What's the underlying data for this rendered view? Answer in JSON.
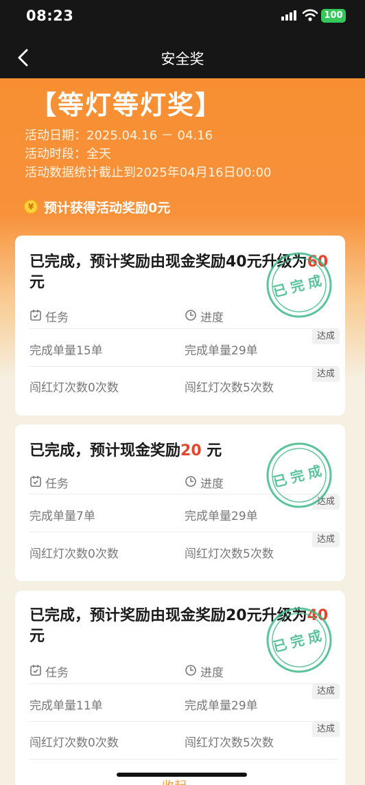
{
  "status_bar": {
    "time": "08:23",
    "battery": "100"
  },
  "nav": {
    "title": "安全奖"
  },
  "hero": {
    "title": "【等灯等灯奖】",
    "date_line": "活动日期：2025.04.16 － 04.16",
    "period_line": "活动时段：全天",
    "stats_line": "活动数据统计截止到2025年04月16日00:00",
    "coin_symbol": "¥",
    "reward": "预计获得活动奖励0元"
  },
  "headers": {
    "task": "任务",
    "progress": "进度"
  },
  "badge_text": "达成",
  "stamp_text": "已完成",
  "cards": [
    {
      "title_text": "已完成，预计奖励由现金奖励40元升级为",
      "amount": "60",
      "unit": " 元",
      "rows": [
        {
          "task": "完成单量15单",
          "progress": "完成单量29单"
        },
        {
          "task": "闯红灯次数0次数",
          "progress": "闯红灯次数5次数"
        }
      ]
    },
    {
      "title_text": "已完成，预计现金奖励",
      "amount": "20",
      "unit": " 元",
      "rows": [
        {
          "task": "完成单量7单",
          "progress": "完成单量29单"
        },
        {
          "task": "闯红灯次数0次数",
          "progress": "闯红灯次数5次数"
        }
      ]
    },
    {
      "title_text": "已完成，预计奖励由现金奖励20元升级为",
      "amount": "40",
      "unit": " 元",
      "rows": [
        {
          "task": "完成单量11单",
          "progress": "完成单量29单"
        },
        {
          "task": "闯红灯次数0次数",
          "progress": "闯红灯次数5次数"
        }
      ]
    }
  ],
  "footer": {
    "collapse": "收起"
  },
  "colors": {
    "accent_orange": "#f78f32",
    "amount_red": "#e5452c",
    "stamp_green": "#3fb98a",
    "topbar": "#161616"
  }
}
